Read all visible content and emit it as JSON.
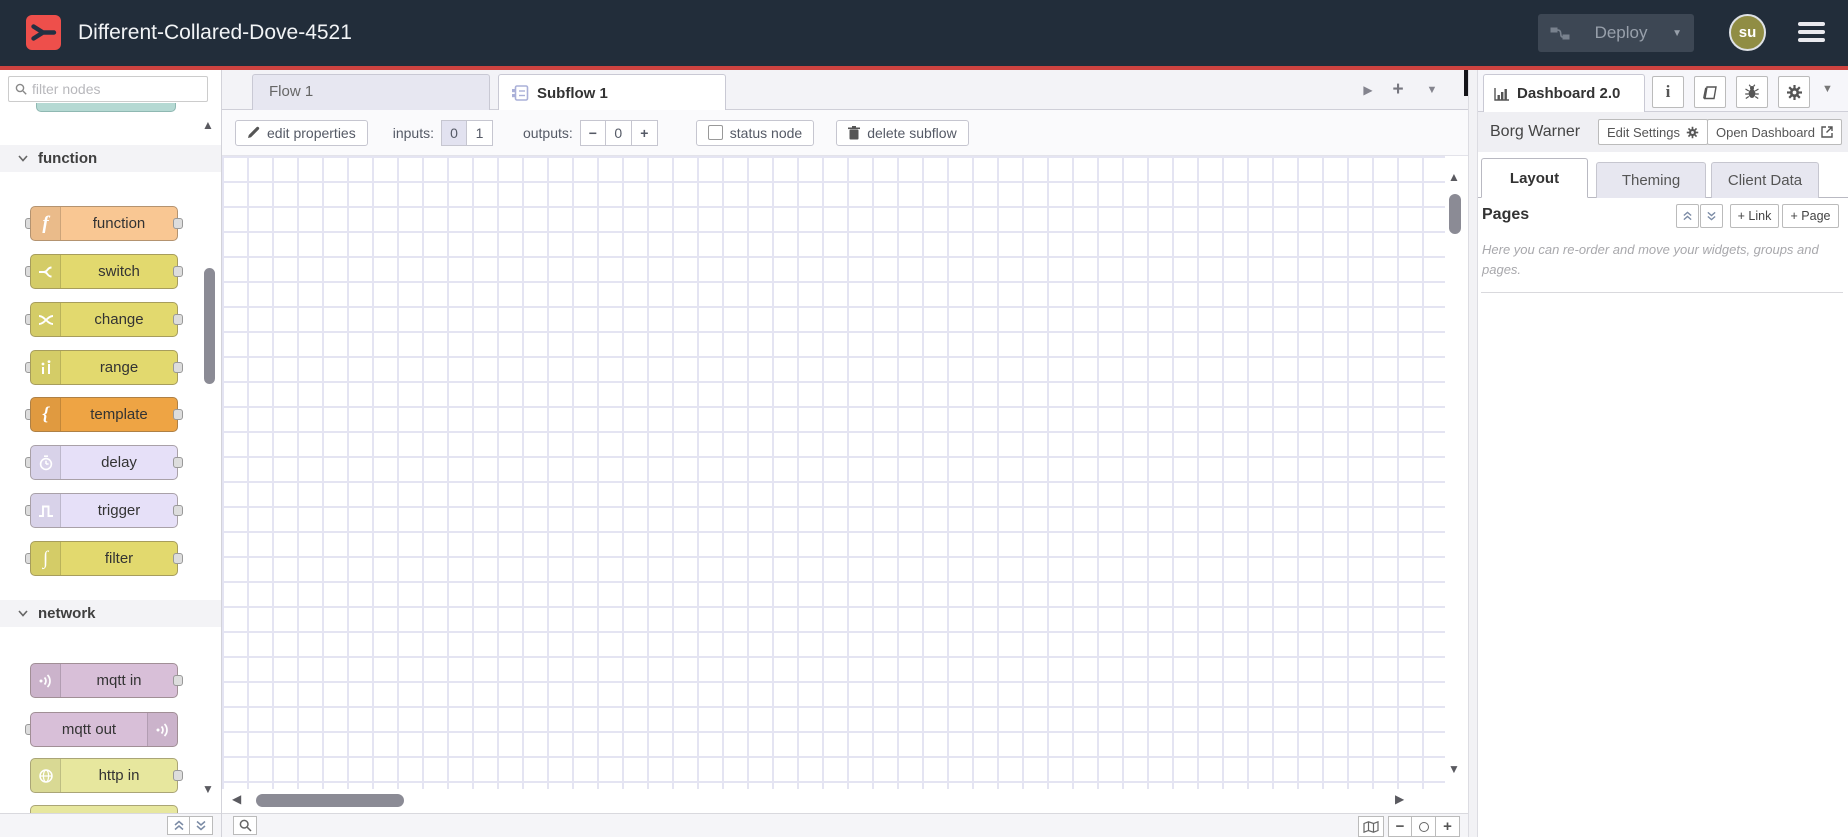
{
  "header": {
    "title": "Different-Collared-Dove-4521",
    "deploy_label": "Deploy",
    "avatar_text": "su"
  },
  "palette": {
    "filter_placeholder": "filter nodes",
    "categories": [
      {
        "label": "function",
        "nodes": [
          {
            "label": "function",
            "color": "#f9c793"
          },
          {
            "label": "switch",
            "color": "#e2d96e"
          },
          {
            "label": "change",
            "color": "#e2d96e"
          },
          {
            "label": "range",
            "color": "#e2d96e"
          },
          {
            "label": "template",
            "color": "#eea444"
          },
          {
            "label": "delay",
            "color": "#e6e0f8"
          },
          {
            "label": "trigger",
            "color": "#e6e0f8"
          },
          {
            "label": "filter",
            "color": "#e2d96e"
          }
        ]
      },
      {
        "label": "network",
        "nodes": [
          {
            "label": "mqtt in",
            "color": "#d8bfd8"
          },
          {
            "label": "mqtt out",
            "color": "#d8bfd8"
          },
          {
            "label": "http in",
            "color": "#e7e79e"
          }
        ]
      }
    ]
  },
  "tabs": {
    "flow": "Flow 1",
    "subflow": "Subflow 1"
  },
  "toolbar": {
    "edit": "edit properties",
    "inputs_label": "inputs:",
    "inputs_options": [
      "0",
      "1"
    ],
    "outputs_label": "outputs:",
    "outputs_value": "0",
    "status": "status node",
    "delete": "delete subflow"
  },
  "sidebar": {
    "tab": "Dashboard 2.0",
    "project": "Borg Warner",
    "edit_settings": "Edit Settings",
    "open_dashboard": "Open Dashboard",
    "tabs": [
      "Layout",
      "Theming",
      "Client Data"
    ],
    "pages_title": "Pages",
    "link_button": "+ Link",
    "page_button": "+ Page",
    "help_text": "Here you can re-order and move your widgets, groups and pages."
  },
  "icons": {
    "caret_down": "▼",
    "caret_up": "▲",
    "caret_left": "◀",
    "caret_right": "▶",
    "plus": "+",
    "minus": "−"
  },
  "colors": {
    "header_bg": "#222d3a",
    "accent_red": "#cf4340",
    "logo_red": "#ee4f4b",
    "avatar_olive": "#908d44",
    "grid_line": "#e4e4f2",
    "tab_inactive": "#e7e7f1"
  }
}
